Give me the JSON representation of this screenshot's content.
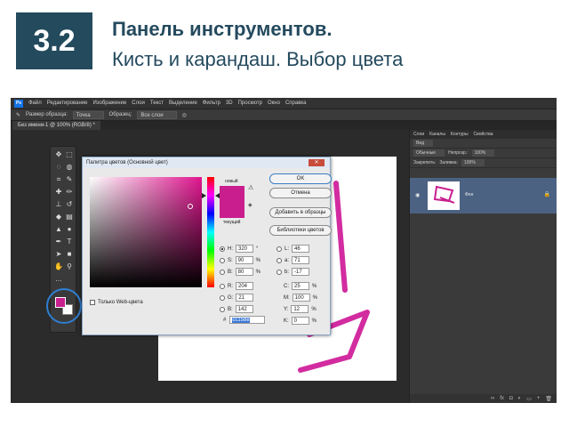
{
  "slide": {
    "number": "3.2",
    "title_line1": "Панель инструментов.",
    "title_line2": "Кисть и карандаш. Выбор цвета"
  },
  "photoshop": {
    "logo": "Ps",
    "menu": [
      "Файл",
      "Редактирование",
      "Изображение",
      "Слои",
      "Текст",
      "Выделение",
      "Фильтр",
      "3D",
      "Просмотр",
      "Окно",
      "Справка"
    ],
    "options": {
      "sample_size_label": "Размер образца:",
      "sample_size_value": "Точка",
      "samples_label": "Образец:",
      "samples_value": "Все слои"
    },
    "doc_tab": "Без имени-1 @ 100% (RGB/8) *",
    "foreground_color": "#c91e8e",
    "background_color": "#ffffff"
  },
  "color_picker": {
    "title": "Палитра цветов (Основной цвет)",
    "label_new": "новый",
    "label_current": "текущий",
    "buttons": {
      "ok": "OK",
      "cancel": "Отмена",
      "add_swatches": "Добавить в образцы",
      "libraries": "Библиотеки цветов"
    },
    "hsb": {
      "h_label": "H:",
      "h_value": "320",
      "h_unit": "°",
      "s_label": "S:",
      "s_value": "90",
      "s_unit": "%",
      "b_label": "B:",
      "b_value": "80",
      "b_unit": "%"
    },
    "rgb": {
      "r_label": "R:",
      "r_value": "204",
      "g_label": "G:",
      "g_value": "21",
      "b_label": "B:",
      "b_value": "142"
    },
    "lab": {
      "l_label": "L:",
      "l_value": "46",
      "a_label": "a:",
      "a_value": "71",
      "b_label": "b:",
      "b_value": "-17"
    },
    "cmyk": {
      "c_label": "C:",
      "c_value": "25",
      "c_unit": "%",
      "m_label": "M:",
      "m_value": "100",
      "m_unit": "%",
      "y_label": "Y:",
      "y_value": "12",
      "y_unit": "%",
      "k_label": "K:",
      "k_value": "0",
      "k_unit": "%"
    },
    "hex_label": "#",
    "hex_value": "cc158e",
    "web_only": "Только Web-цвета",
    "selected_color": "#c91e8e"
  },
  "layers_panel": {
    "tabs": [
      "Слои",
      "Каналы",
      "Контуры",
      "Свойства"
    ],
    "search_placeholder": "Вид",
    "blend_mode": "Обычные",
    "opacity_label": "Непрозр.:",
    "opacity_value": "100%",
    "lock_label": "Закрепить:",
    "fill_label": "Заливка:",
    "fill_value": "100%",
    "layer_name": "Фон"
  }
}
